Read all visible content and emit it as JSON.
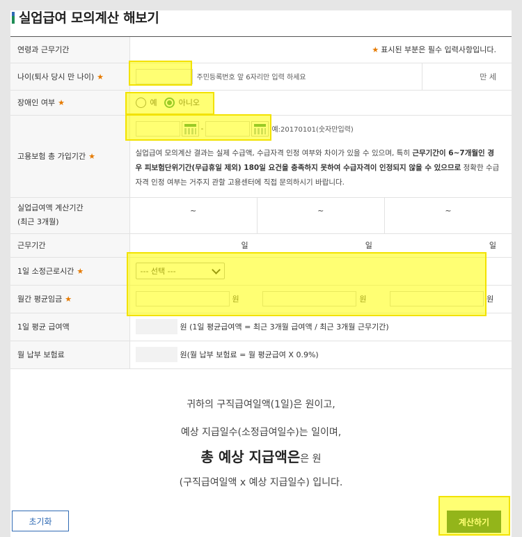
{
  "page": {
    "title": "실업급여 모의계산 해보기"
  },
  "rows": {
    "age_work": {
      "label": "연령과 근무기간",
      "required_note": "표시된 부분은 필수 입력사항입니다.",
      "note_star": "★"
    },
    "age": {
      "label": "나이(퇴사 당시 만 나이)",
      "star": "★",
      "input_value": "",
      "hint": "주민등록번호 앞 6자리만 입력 하세요",
      "unit": "만 세"
    },
    "disability": {
      "label": "장애인 여부",
      "star": "★",
      "option_yes": "예",
      "option_no": "아니오",
      "selected": "아니오"
    },
    "insurance_period": {
      "label": "고용보험 총 가입기간",
      "star": "★",
      "start_value": "",
      "end_value": "",
      "separator": "-",
      "format_hint": "예:20170101(숫자만입력)",
      "notice_parts": [
        "실업급여 모의계산 결과는 실제 수급액, 수급자격 인정 여부와 차이가 있을 수 있으며, 특히 ",
        "근무기간이 6~7개월인 경우 피보험단위기간(무급휴일 제외) 180일 요건을 충족하지 못하여 수급자격이 인정되지 않을 수 있으므로",
        " 정확한 수급자격 인정 여부는 거주지 관할 고용센터에 직접 문의하시기 바랍니다."
      ]
    },
    "calc_period": {
      "label_line1": "실업급여액 계산기간",
      "label_line2": "(최근 3개월)",
      "cells": [
        "~",
        "~",
        "~"
      ]
    },
    "work_days": {
      "label": "근무기간",
      "unit": "일"
    },
    "daily_hours": {
      "label": "1일 소정근로시간",
      "star": "★",
      "selected": "--- 선택 ---"
    },
    "monthly_wage": {
      "label": "월간 평균임금",
      "star": "★",
      "unit": "원",
      "values": [
        "",
        "",
        ""
      ]
    },
    "daily_avg": {
      "label": "1일 평균 급여액",
      "formula": "원 (1일 평균급여액 = 최근 3개월 급여액 / 최근 3개월 근무기간)"
    },
    "monthly_premium": {
      "label": "월 납부 보험료",
      "formula": "원(월 납부 보험료 = 월 평균급여 X 0.9%)"
    }
  },
  "summary": {
    "line1": "귀하의 구직급여일액(1일)은 원이고,",
    "line2": "예상 지급일수(소정급여일수)는 일이며,",
    "line3_big": "총 예상 지급액은",
    "line3_small": "은 원",
    "line4": "(구직급여일액 x 예상 지급일수) 입니다."
  },
  "buttons": {
    "reset": "초기화",
    "calculate": "계산하기"
  },
  "colors": {
    "accent": "#1f8d56",
    "button": "#105b3a",
    "required": "#e57a00",
    "link": "#2f6ab4",
    "highlight": "#ffff00"
  }
}
